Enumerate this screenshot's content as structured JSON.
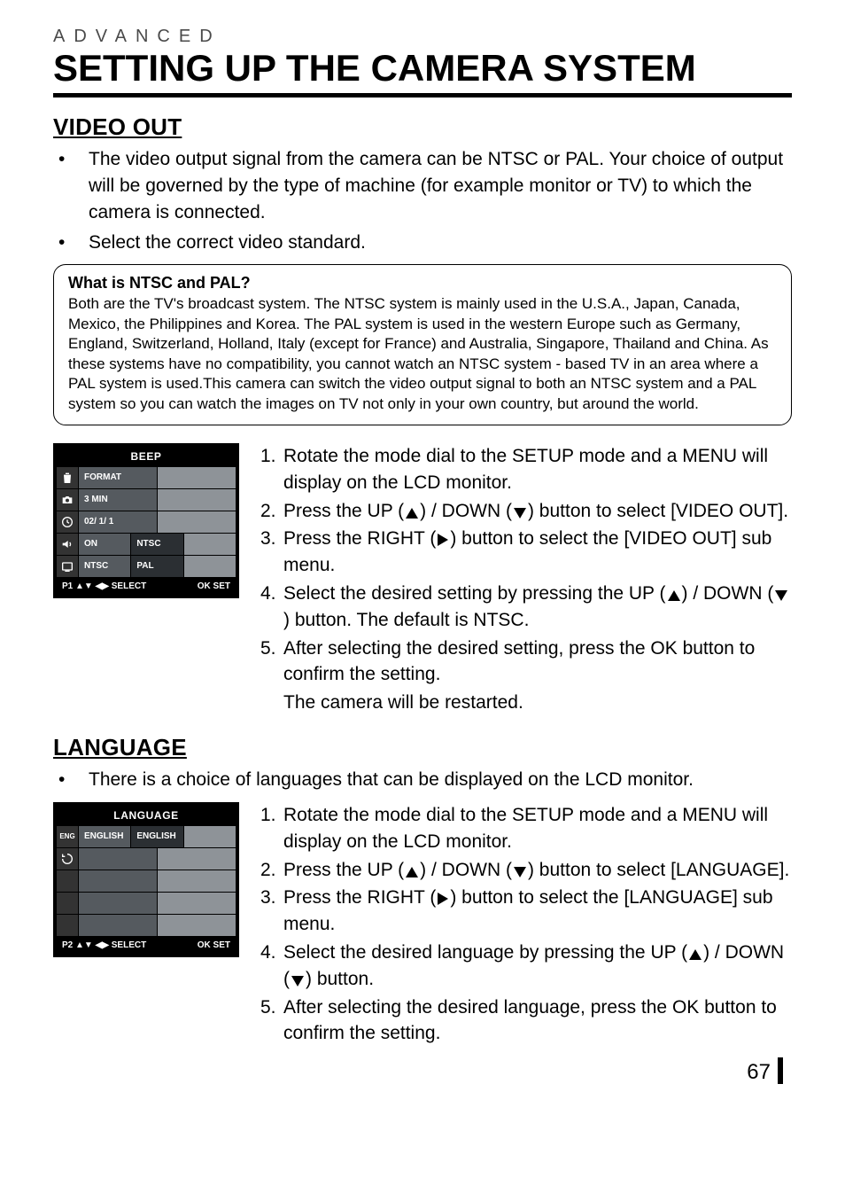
{
  "kicker": "ADVANCED",
  "title": "SETTING UP THE CAMERA SYSTEM",
  "page_number": "67",
  "sections": {
    "video_out": {
      "heading": "VIDEO OUT",
      "bullets": [
        "The video output signal from the camera can be NTSC or PAL. Your choice of output will be governed by the type of machine (for example monitor or TV) to which the camera is connected.",
        "Select the correct video standard."
      ],
      "infobox": {
        "title": "What is NTSC and PAL?",
        "body": "Both are the TV's broadcast system. The NTSC system is mainly used in the U.S.A., Japan, Canada, Mexico, the Philippines and Korea. The PAL system is used in the western Europe such as Germany, England, Switzerland, Holland, Italy (except for France) and Australia, Singapore, Thailand and China. As these systems have no compatibility, you cannot watch an NTSC system - based TV in an area where a PAL system is used.This camera can switch the video output signal to both an NTSC system and a PAL system so you can watch the images on TV not only in your own country, but around the world."
      },
      "lcd": {
        "header": "BEEP",
        "rows": [
          {
            "icon": "trash-icon",
            "c1": "FORMAT",
            "c2": "",
            "c3": ""
          },
          {
            "icon": "camera-icon",
            "c1": "3 MIN",
            "c2": "",
            "c3": ""
          },
          {
            "icon": "clock-icon",
            "c1": "02/ 1/ 1",
            "c2": "",
            "c3": ""
          },
          {
            "icon": "speaker-icon",
            "c1": "ON",
            "c2": "NTSC",
            "c3": ""
          },
          {
            "icon": "tv-icon",
            "c1": "NTSC",
            "c2": "PAL",
            "c3": ""
          }
        ],
        "footer_left": "P1  ▲▼ ◀▶  SELECT",
        "footer_right": "OK  SET"
      },
      "steps": [
        {
          "n": "1.",
          "t_a": "Rotate the mode dial to the SETUP mode and a MENU will display on the LCD monitor."
        },
        {
          "n": "2.",
          "t_a": "Press the UP (",
          "icon1": "up",
          "t_b": ") / DOWN (",
          "icon2": "down",
          "t_c": ") button to select [VIDEO OUT]."
        },
        {
          "n": "3.",
          "t_a": "Press the RIGHT (",
          "icon1": "right",
          "t_b": ") button to select the [VIDEO OUT] sub menu."
        },
        {
          "n": "4.",
          "t_a": "Select the desired setting by pressing the UP (",
          "icon1": "up",
          "t_b": ") / DOWN (",
          "icon2": "down",
          "t_c": ") button. The default is NTSC."
        },
        {
          "n": "5.",
          "t_a": "After selecting the desired setting, press the OK button to confirm the setting.",
          "sub": "The camera will be restarted."
        }
      ]
    },
    "language": {
      "heading": "LANGUAGE",
      "bullets": [
        "There is a choice of languages that can be displayed on the LCD monitor."
      ],
      "lcd": {
        "header": "LANGUAGE",
        "rows": [
          {
            "icon": "eng-icon",
            "c1": "ENGLISH",
            "c2": "ENGLISH",
            "c3": ""
          },
          {
            "icon": "reset-icon",
            "c1": "",
            "c2": "",
            "c3": ""
          },
          {
            "icon": "",
            "c1": "",
            "c2": "",
            "c3": ""
          },
          {
            "icon": "",
            "c1": "",
            "c2": "",
            "c3": ""
          },
          {
            "icon": "",
            "c1": "",
            "c2": "",
            "c3": ""
          }
        ],
        "footer_left": "P2  ▲▼ ◀▶  SELECT",
        "footer_right": "OK  SET"
      },
      "steps": [
        {
          "n": "1.",
          "t_a": "Rotate the mode dial to the SETUP mode and a MENU will display on the LCD monitor."
        },
        {
          "n": "2.",
          "t_a": "Press the UP (",
          "icon1": "up",
          "t_b": ") / DOWN (",
          "icon2": "down",
          "t_c": ") button to select [LANGUAGE]."
        },
        {
          "n": "3.",
          "t_a": "Press the RIGHT (",
          "icon1": "right",
          "t_b": ") button to select the [LANGUAGE] sub menu."
        },
        {
          "n": "4.",
          "t_a": "Select the desired language by pressing the UP (",
          "icon1": "up",
          "t_b": ") / DOWN (",
          "icon2": "down",
          "t_c": ") button."
        },
        {
          "n": "5.",
          "t_a": "After selecting the desired language, press the OK button to confirm the setting."
        }
      ]
    }
  }
}
